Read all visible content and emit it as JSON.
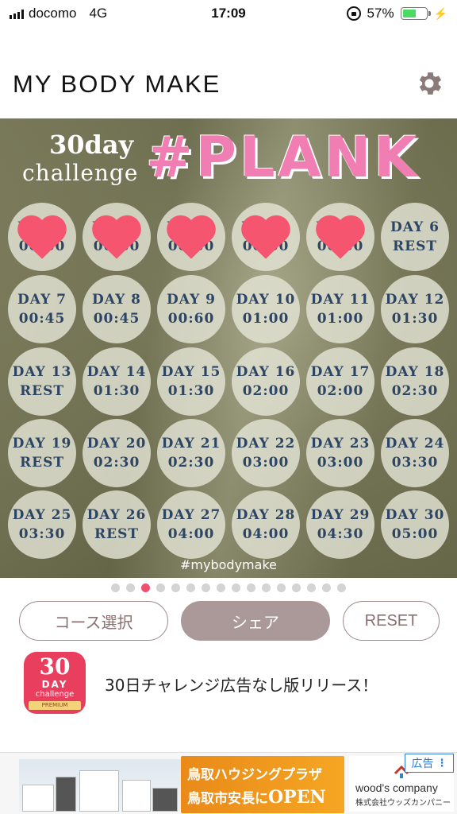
{
  "status_bar": {
    "carrier": "docomo",
    "network": "4G",
    "time": "17:09",
    "battery_percent": "57%",
    "battery_level": 0.57
  },
  "header": {
    "app_title": "MY BODY MAKE",
    "settings_icon": "gear-icon"
  },
  "calendar": {
    "title_number": "30day",
    "title_word": "challenge",
    "title_tag": "#PLANK",
    "hashtag": "#mybodymake",
    "completed_icon": "heart-icon",
    "completed_color": "#f5556e",
    "days": [
      {
        "day": "DAY 1",
        "value": "00:30",
        "done": true
      },
      {
        "day": "DAY 2",
        "value": "00:30",
        "done": true
      },
      {
        "day": "DAY 3",
        "value": "00:30",
        "done": true
      },
      {
        "day": "DAY 4",
        "value": "00:30",
        "done": true
      },
      {
        "day": "DAY 5",
        "value": "00:30",
        "done": true
      },
      {
        "day": "DAY 6",
        "value": "REST",
        "done": false
      },
      {
        "day": "DAY 7",
        "value": "00:45",
        "done": false
      },
      {
        "day": "DAY 8",
        "value": "00:45",
        "done": false
      },
      {
        "day": "DAY 9",
        "value": "00:60",
        "done": false
      },
      {
        "day": "DAY 10",
        "value": "01:00",
        "done": false
      },
      {
        "day": "DAY 11",
        "value": "01:00",
        "done": false
      },
      {
        "day": "DAY 12",
        "value": "01:30",
        "done": false
      },
      {
        "day": "DAY 13",
        "value": "REST",
        "done": false
      },
      {
        "day": "DAY 14",
        "value": "01:30",
        "done": false
      },
      {
        "day": "DAY 15",
        "value": "01:30",
        "done": false
      },
      {
        "day": "DAY 16",
        "value": "02:00",
        "done": false
      },
      {
        "day": "DAY 17",
        "value": "02:00",
        "done": false
      },
      {
        "day": "DAY 18",
        "value": "02:30",
        "done": false
      },
      {
        "day": "DAY 19",
        "value": "REST",
        "done": false
      },
      {
        "day": "DAY 20",
        "value": "02:30",
        "done": false
      },
      {
        "day": "DAY 21",
        "value": "02:30",
        "done": false
      },
      {
        "day": "DAY 22",
        "value": "03:00",
        "done": false
      },
      {
        "day": "DAY 23",
        "value": "03:00",
        "done": false
      },
      {
        "day": "DAY 24",
        "value": "03:30",
        "done": false
      },
      {
        "day": "DAY 25",
        "value": "03:30",
        "done": false
      },
      {
        "day": "DAY 26",
        "value": "REST",
        "done": false
      },
      {
        "day": "DAY 27",
        "value": "04:00",
        "done": false
      },
      {
        "day": "DAY 28",
        "value": "04:00",
        "done": false
      },
      {
        "day": "DAY 29",
        "value": "04:30",
        "done": false
      },
      {
        "day": "DAY 30",
        "value": "05:00",
        "done": false
      }
    ]
  },
  "pager": {
    "page_count": 16,
    "current_page": 3,
    "active_color": "#f0506e"
  },
  "buttons": {
    "course_select": "コース選択",
    "share": "シェア",
    "reset": "RESET"
  },
  "promo": {
    "icon_number": "30",
    "icon_day": "DAY",
    "icon_challenge": "challenge",
    "icon_premium": "PREMIUM",
    "text": "30日チャレンジ広告なし版リリース！"
  },
  "ad": {
    "line1": "鳥取ハウジングプラザ",
    "line2": "鳥取市安長に",
    "line2_emph": "OPEN",
    "company_name": "wood's company",
    "company_name_ja": "株式会社ウッズカンパニー",
    "badge": "広告"
  }
}
